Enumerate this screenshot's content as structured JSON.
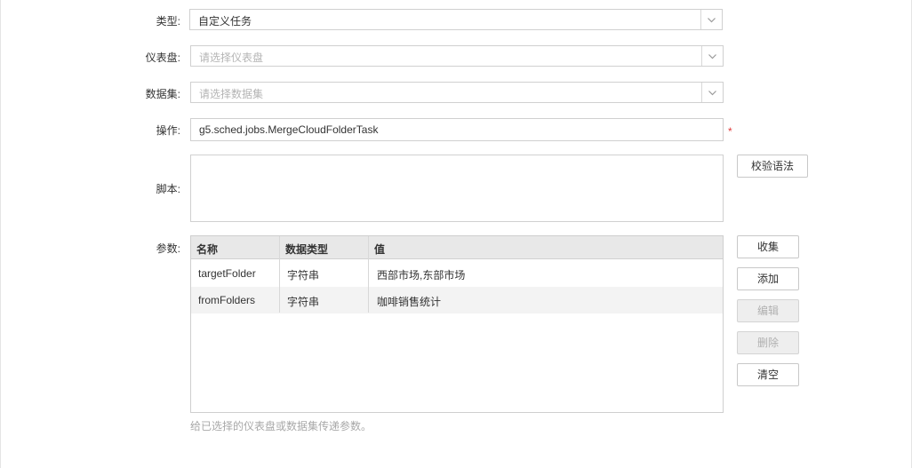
{
  "form": {
    "task_type": {
      "label": "类型:",
      "value": "自定义任务"
    },
    "dashboard": {
      "label": "仪表盘:",
      "placeholder": "请选择仪表盘"
    },
    "dataset": {
      "label": "数据集:",
      "placeholder": "请选择数据集"
    },
    "operation": {
      "label": "操作:",
      "value": "g5.sched.jobs.MergeCloudFolderTask",
      "required_mark": "*"
    },
    "script": {
      "label": "脚本:",
      "value": "",
      "validate_button": "校验语法"
    },
    "params": {
      "label": "参数:",
      "columns": [
        "名称",
        "数据类型",
        "值"
      ],
      "rows": [
        {
          "name": "targetFolder",
          "type": "字符串",
          "value": "西部市场,东部市场"
        },
        {
          "name": "fromFolders",
          "type": "字符串",
          "value": "咖啡销售统计"
        }
      ],
      "buttons": {
        "collect": "收集",
        "add": "添加",
        "edit": "编辑",
        "delete": "删除",
        "clear": "清空"
      },
      "hint": "给已选择的仪表盘或数据集传递参数。"
    }
  },
  "colors": {
    "required": "#e03a3a",
    "header_bg": "#e8e8e8",
    "disabled_bg": "#eeeeee"
  },
  "icons": {
    "dropdown": "chevron-down-icon"
  }
}
